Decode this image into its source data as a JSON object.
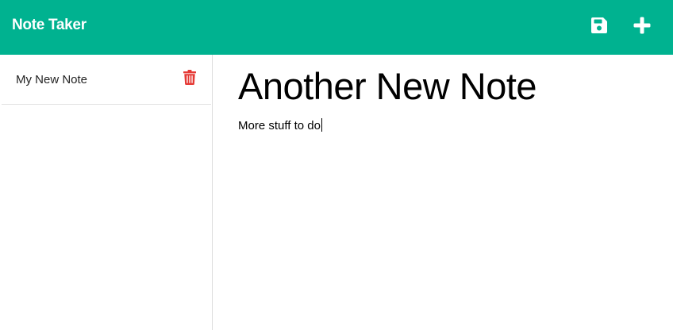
{
  "navbar": {
    "brand": "Note Taker",
    "save_icon": "save-icon",
    "new_icon": "plus-icon",
    "bg_color": "#00b290"
  },
  "sidebar": {
    "notes": [
      {
        "title": "My New Note",
        "delete_icon": "trash-icon",
        "delete_color": "#e53935"
      }
    ]
  },
  "editor": {
    "title": "Another New Note",
    "text": "More stuff to do"
  }
}
